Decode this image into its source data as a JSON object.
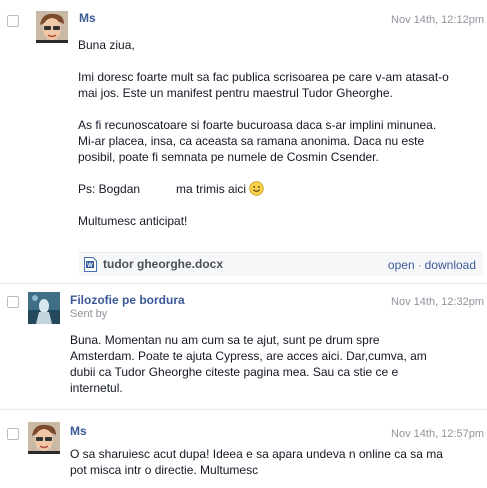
{
  "messages": [
    {
      "sender": "Ms",
      "time": "Nov 14th, 12:12pm",
      "paragraphs": [
        "Buna ziua,",
        "Imi doresc foarte mult sa fac publica scrisoarea pe care v-am atasat-o",
        "mai jos. Este un manifest pentru maestrul Tudor Gheorghe.",
        "As fi recunoscatoare si foarte bucuroasa daca s-ar implini minunea.",
        "Mi-ar placea, insa, ca aceasta sa ramana anonima. Daca nu este",
        "posibil, poate fi semnata pe numele de Cosmin Csender.",
        "Ps: Bogdan",
        "ma trimis aici",
        "Multumesc anticipat!"
      ],
      "attachment": {
        "filename": "tudor gheorghe.docx",
        "open_label": "open",
        "separator": "·",
        "download_label": "download"
      }
    },
    {
      "sender": "Filozofie pe bordura",
      "sent_by": "Sent by",
      "time": "Nov 14th, 12:32pm",
      "lines": [
        "Buna. Momentan nu am cum sa te ajut, sunt pe drum spre",
        "Amsterdam. Poate te ajuta Cypress, are acces aici. Dar,cumva, am",
        "dubii ca Tudor Gheorghe citeste pagina mea. Sau ca stie ce e",
        "internetul."
      ]
    },
    {
      "sender": "Ms",
      "time": "Nov 14th, 12:57pm",
      "lines": [
        "O sa sharuiesc acut dupa! Ideea e sa apara undeva n online ca sa ma",
        "pot misca intr o directie. Multumesc"
      ]
    }
  ]
}
